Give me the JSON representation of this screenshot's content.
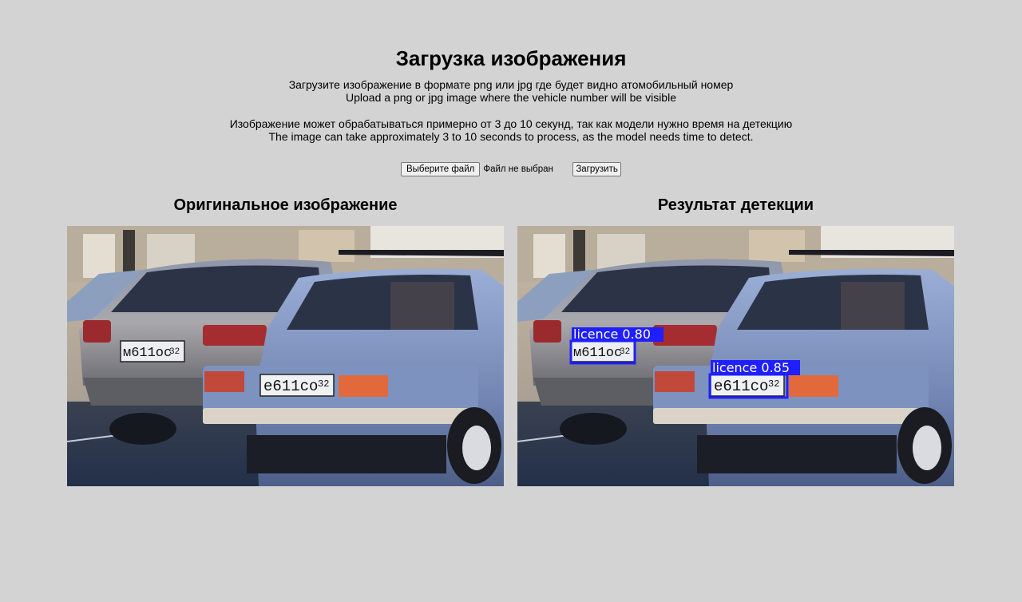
{
  "header": {
    "title": "Загрузка изображения",
    "line1_ru": "Загрузите изображение в формате png или jpg где будет видно атомобильный номер",
    "line1_en": "Upload a png or jpg image where the vehicle number will be visible",
    "line2_ru": "Изображение может обрабатываться примерно от 3 до 10 секунд, так как модели нужно время на детекцию",
    "line2_en": "The image can take approximately 3 to 10 seconds to process, as the model needs time to detect."
  },
  "form": {
    "choose_file_label": "Выберите файл",
    "file_status": "Файл не выбран",
    "upload_label": "Загрузить"
  },
  "panels": {
    "original_title": "Оригинальное изображение",
    "result_title": "Результат детекции"
  },
  "plates": {
    "audi": {
      "text": "м611ос",
      "region": "32"
    },
    "lada": {
      "text": "е611со",
      "region": "32"
    }
  },
  "detections": [
    {
      "label": "licence 0.80"
    },
    {
      "label": "licence 0.85"
    }
  ],
  "colors": {
    "background": "#d3d3d3",
    "detection_box": "#1f1fff",
    "lada_body": "#7d92bf",
    "audi_body": "#a3a4ab"
  }
}
